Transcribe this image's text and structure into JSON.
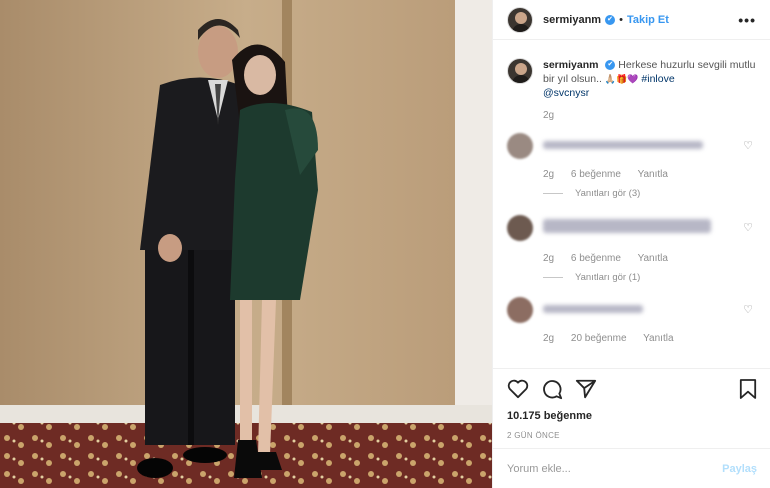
{
  "header": {
    "username": "sermiyanm",
    "separator": "•",
    "follow_label": "Takip Et",
    "more_label": "•••"
  },
  "caption": {
    "username": "sermiyanm",
    "text": "Herkese huzurlu sevgili mutlu bir yıl olsun..",
    "emojis": "🙏🏼🎁💜",
    "hashtag": "#inlove",
    "mention": "@svcnysr",
    "time": "2g"
  },
  "comments": [
    {
      "time": "2g",
      "likes": "6 beğenme",
      "reply": "Yanıtla",
      "view_replies": "Yanıtları gör (3)"
    },
    {
      "time": "2g",
      "likes": "6 beğenme",
      "reply": "Yanıtla",
      "view_replies": "Yanıtları gör (1)"
    },
    {
      "time": "2g",
      "likes": "20 beğenme",
      "reply": "Yanıtla"
    }
  ],
  "actions": {
    "likes": "10.175 beğenme",
    "time": "2 GÜN ÖNCE"
  },
  "add_comment": {
    "placeholder": "Yorum ekle...",
    "post_label": "Paylaş"
  },
  "colors": {
    "accent": "#3897f0",
    "post_disabled": "#b2dffc"
  },
  "icons": [
    "heart-icon",
    "comment-icon",
    "share-icon",
    "bookmark-icon",
    "verified-icon",
    "more-icon"
  ]
}
